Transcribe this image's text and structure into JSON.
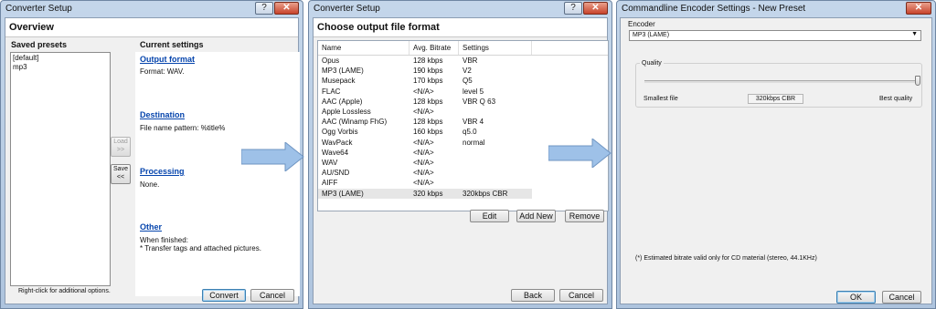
{
  "dlg1": {
    "title": "Converter Setup",
    "header": "Overview",
    "saved_presets_label": "Saved presets",
    "presets": [
      "[default]",
      "mp3"
    ],
    "hint": "Right-click for additional options.",
    "load_label": "Load\n>>",
    "save_label": "Save\n<<",
    "current_settings_label": "Current settings",
    "output_format_link": "Output format",
    "output_format_text": "Format: WAV.",
    "destination_link": "Destination",
    "destination_text": "File name pattern: %title%",
    "processing_link": "Processing",
    "processing_text": "None.",
    "other_link": "Other",
    "other_text_1": "When finished:",
    "other_text_2": "* Transfer tags and attached pictures.",
    "convert_label": "Convert",
    "cancel_label": "Cancel"
  },
  "dlg2": {
    "title": "Converter Setup",
    "header": "Choose output file format",
    "columns": [
      "Name",
      "Avg. Bitrate",
      "Settings"
    ],
    "rows": [
      [
        "Opus",
        "128 kbps",
        "VBR"
      ],
      [
        "MP3 (LAME)",
        "190 kbps",
        "V2"
      ],
      [
        "Musepack",
        "170 kbps",
        "Q5"
      ],
      [
        "FLAC",
        "<N/A>",
        "level 5"
      ],
      [
        "AAC (Apple)",
        "128 kbps",
        "VBR Q 63"
      ],
      [
        "Apple Lossless",
        "<N/A>",
        ""
      ],
      [
        "AAC (Winamp FhG)",
        "128 kbps",
        "VBR 4"
      ],
      [
        "Ogg Vorbis",
        "160 kbps",
        "q5.0"
      ],
      [
        "WavPack",
        "<N/A>",
        "normal"
      ],
      [
        "Wave64",
        "<N/A>",
        ""
      ],
      [
        "WAV",
        "<N/A>",
        ""
      ],
      [
        "AU/SND",
        "<N/A>",
        ""
      ],
      [
        "AIFF",
        "<N/A>",
        ""
      ],
      [
        "MP3 (LAME)",
        "320 kbps",
        "320kbps CBR"
      ]
    ],
    "edit_label": "Edit",
    "add_new_label": "Add New",
    "remove_label": "Remove",
    "back_label": "Back",
    "cancel_label": "Cancel"
  },
  "dlg3": {
    "title": "Commandline Encoder Settings - New Preset",
    "encoder_label": "Encoder",
    "encoder_value": "MP3 (LAME)",
    "quality_label": "Quality",
    "quality_level": 1.0,
    "smallest_label": "Smallest file",
    "best_label": "Best quality",
    "bitrate_value": "320kbps CBR",
    "note": "(*) Estimated bitrate valid only for CD material (stereo, 44.1KHz)",
    "ok_label": "OK",
    "cancel_label": "Cancel"
  },
  "colors": {
    "arrow_fill": "#9ec1e8",
    "link": "#0645ad",
    "accent_border": "#3c7fb1"
  }
}
